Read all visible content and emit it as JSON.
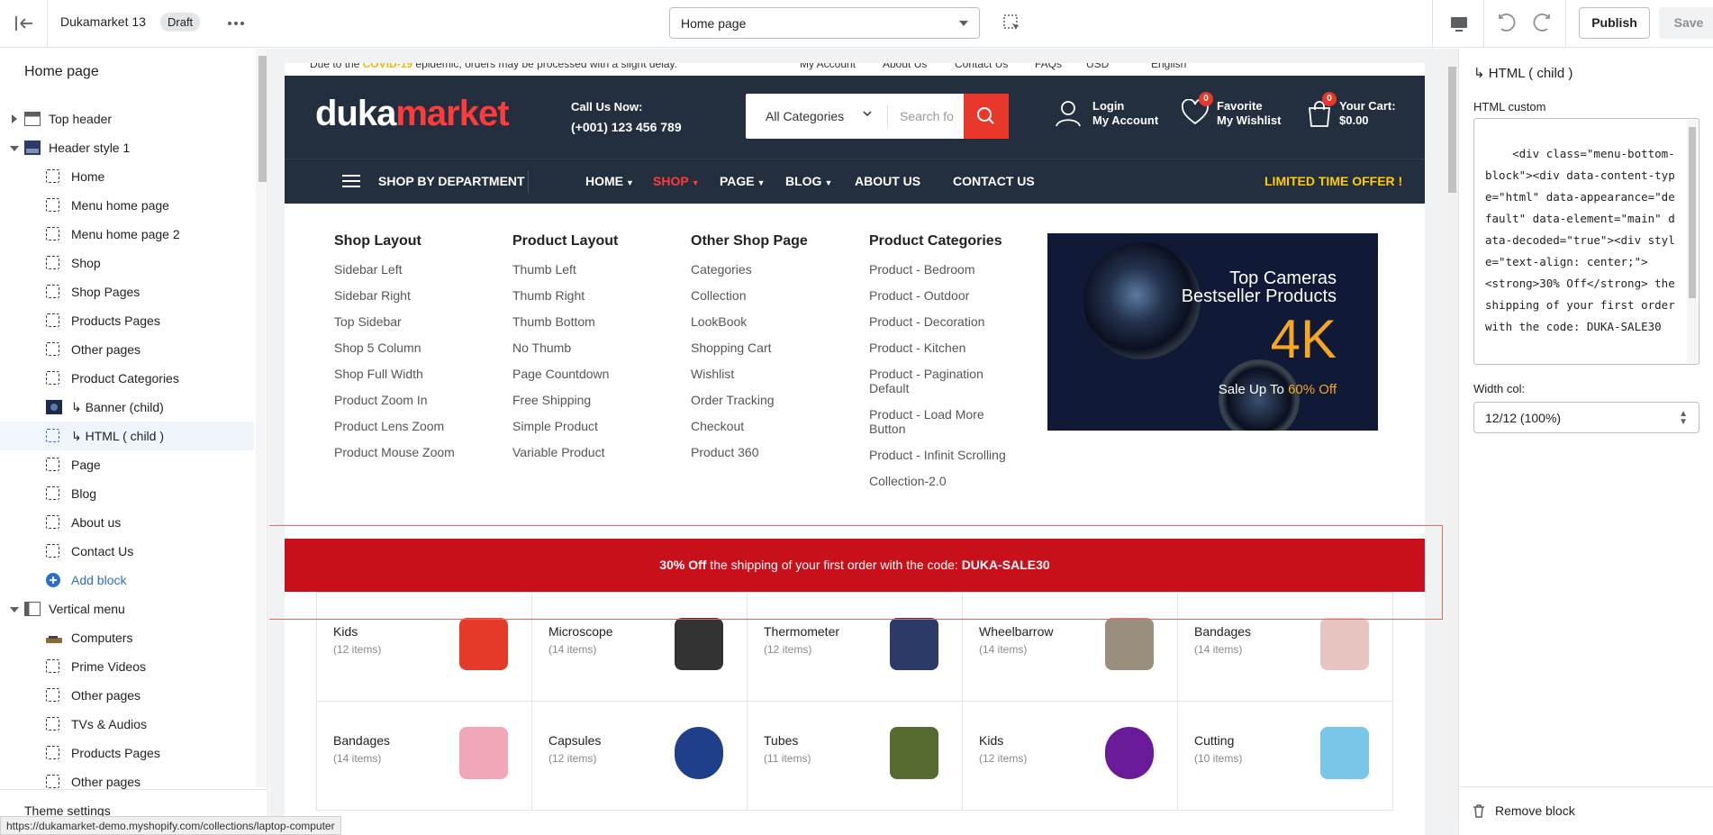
{
  "topbar": {
    "theme_name": "Dukamarket 13",
    "status_badge": "Draft",
    "page_selector": "Home page",
    "publish": "Publish",
    "save": "Save"
  },
  "sidebar": {
    "title": "Home page",
    "sections": [
      {
        "label": "Top header",
        "expanded": false,
        "icon": "section-icon"
      },
      {
        "label": "Header style 1",
        "expanded": true,
        "icon": "section-image-icon",
        "blocks": [
          "Home",
          "Menu home page",
          "Menu home page 2",
          "Shop",
          "Shop Pages",
          "Products Pages",
          "Other pages",
          "Product Categories",
          "↳ Banner (child)",
          "↳ HTML ( child )",
          "Page",
          "Blog",
          "About us",
          "Contact Us"
        ],
        "add_block": "Add block"
      },
      {
        "label": "Vertical menu",
        "expanded": true,
        "icon": "section-icon",
        "blocks": [
          "Computers",
          "Prime Videos",
          "Other pages",
          "TVs & Audios",
          "Products Pages",
          "Other pages"
        ]
      }
    ],
    "footer": "Theme settings"
  },
  "status_url": "https://dukamarket-demo.myshopify.com/collections/laptop-computer",
  "inspector": {
    "title": "↳ HTML ( child )",
    "html_label": "HTML custom",
    "html_value": "<div class=\"menu-bottom-block\"><div data-content-type=\"html\" data-appearance=\"default\" data-element=\"main\" data-decoded=\"true\"><div style=\"text-align: center;\">\n<strong>30% Off</strong> the shipping of your first order with the code: DUKA-SALE30",
    "width_label": "Width col:",
    "width_value": "12/12 (100%)",
    "remove": "Remove block"
  },
  "site": {
    "topstrip": {
      "notice_start": "Due to the ",
      "notice_highlight": "COVID-19",
      "notice_end": " epidemic, orders may be processed with a slight delay.",
      "links": [
        "My Account",
        "About Us",
        "Contact Us",
        "FAQs",
        "USD",
        "English"
      ]
    },
    "logo_a": "duka",
    "logo_b": "market",
    "call_label": "Call Us Now:",
    "call_number": "(+001) 123 456 789",
    "search_category": "All Categories",
    "search_placeholder": "Search for products",
    "login_1": "Login",
    "login_2": "My Account",
    "wish_1": "Favorite",
    "wish_2": "My Wishlist",
    "wish_count": "0",
    "cart_1": "Your Cart:",
    "cart_2": "$0.00",
    "cart_count": "0",
    "nav": {
      "department": "SHOP BY DEPARTMENT",
      "items": [
        "HOME",
        "SHOP",
        "PAGE",
        "BLOG",
        "ABOUT US",
        "CONTACT US"
      ],
      "offer": "LIMITED TIME OFFER !"
    },
    "mega": [
      {
        "title": "Shop Layout",
        "links": [
          "Sidebar Left",
          "Sidebar Right",
          "Top Sidebar",
          "Shop 5 Column",
          "Shop Full Width",
          "Product Zoom In",
          "Product Lens Zoom",
          "Product Mouse Zoom"
        ]
      },
      {
        "title": "Product Layout",
        "links": [
          "Thumb Left",
          "Thumb Right",
          "Thumb Bottom",
          "No Thumb",
          "Page Countdown",
          "Free Shipping",
          "Simple Product",
          "Variable Product"
        ]
      },
      {
        "title": "Other Shop Page",
        "links": [
          "Categories",
          "Collection",
          "LookBook",
          "Shopping Cart",
          "Wishlist",
          "Order Tracking",
          "Checkout",
          "Product 360"
        ]
      },
      {
        "title": "Product Categories",
        "links": [
          "Product - Bedroom",
          "Product - Outdoor",
          "Product - Decoration",
          "Product - Kitchen",
          "Product - Pagination Default",
          "Product - Load More Button",
          "Product - Infinit Scrolling",
          "Collection-2.0"
        ]
      }
    ],
    "banner": {
      "line1": "Top Cameras",
      "line2": "Bestseller Products",
      "big": "4K",
      "sale_prefix": "Sale Up To ",
      "sale_value": "60% Off"
    },
    "promo": {
      "bold": "30% Off",
      "text": " the shipping of your first order with the code: ",
      "code": "DUKA-SALE30"
    },
    "categories": [
      {
        "name": "Kids",
        "count": "(12 items)",
        "icon": "speaker-image",
        "color": "#e53a2a"
      },
      {
        "name": "Microscope",
        "count": "(14 items)",
        "icon": "chair-image",
        "color": "#333333"
      },
      {
        "name": "Thermometer",
        "count": "(12 items)",
        "icon": "backpack-image",
        "color": "#2b3a67"
      },
      {
        "name": "Wheelbarrow",
        "count": "(14 items)",
        "icon": "watch-image",
        "color": "#9a8f7d"
      },
      {
        "name": "Bandages",
        "count": "(14 items)",
        "icon": "tablet-image",
        "color": "#e8c4c0"
      },
      {
        "name": "Bandages",
        "count": "(14 items)",
        "icon": "gamepad-image",
        "color": "#f2a7b8"
      },
      {
        "name": "Capsules",
        "count": "(12 items)",
        "icon": "fan-image",
        "color": "#1f3f8a"
      },
      {
        "name": "Tubes",
        "count": "(11 items)",
        "icon": "bag-speaker-image",
        "color": "#556b2f"
      },
      {
        "name": "Kids",
        "count": "(12 items)",
        "icon": "headphones-image",
        "color": "#6a1b9a"
      },
      {
        "name": "Cutting",
        "count": "(10 items)",
        "icon": "card-image",
        "color": "#7ac6e8"
      }
    ]
  }
}
